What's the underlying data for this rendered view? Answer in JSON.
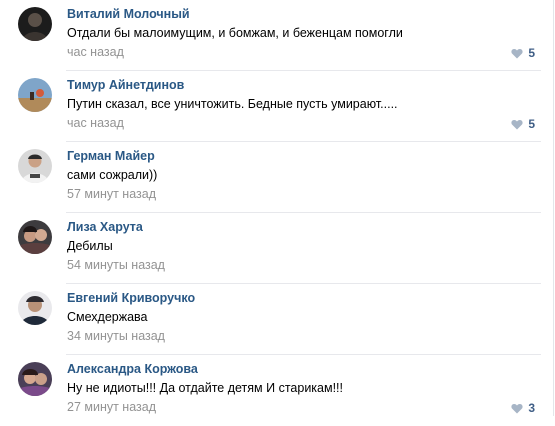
{
  "comments": [
    {
      "author": "Виталий Молочный",
      "text": "Отдали бы малоимущим, и бомжам, и беженцам помогли",
      "time": "час назад",
      "likes": "5",
      "like_icon": "heart-icon"
    },
    {
      "author": "Тимур Айнетдинов",
      "text": "Путин сказал, все уничтожить. Бедные пусть умирают.....",
      "time": "час назад",
      "likes": "5",
      "like_icon": "heart-icon"
    },
    {
      "author": "Герман Майер",
      "text": "сами сожрали))",
      "time": "57 минут назад"
    },
    {
      "author": "Лиза Харута",
      "text": "Дебилы",
      "time": "54 минуты назад"
    },
    {
      "author": "Евгений Криворучко",
      "text": "Смехдержава",
      "time": "34 минуты назад"
    },
    {
      "author": "Александра Коржова",
      "text": "Ну не идиоты!!! Да отдайте детям И старикам!!!",
      "time": "27 минут назад",
      "likes": "3",
      "like_icon": "heart-icon"
    }
  ],
  "colors": {
    "author": "#2a5885",
    "time": "#939393",
    "like": "#3f5e86",
    "heart": "#a7b5c6",
    "divider": "#e7e8ec"
  }
}
